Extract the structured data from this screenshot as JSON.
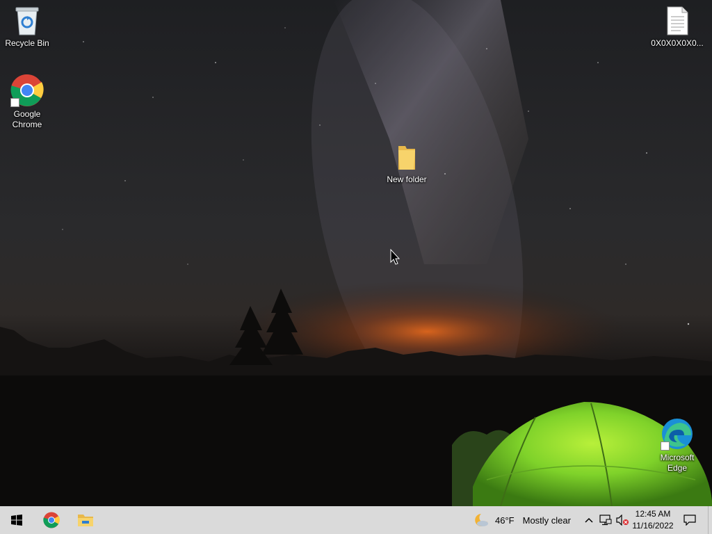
{
  "desktop": {
    "icons": [
      {
        "label": "Recycle Bin",
        "icon": "recycle-bin-icon"
      },
      {
        "label": "Google Chrome",
        "icon": "chrome-icon"
      },
      {
        "label": "New folder",
        "icon": "folder-icon"
      },
      {
        "label": "0X0X0X0X0...",
        "icon": "text-file-icon"
      },
      {
        "label": "Microsoft Edge",
        "icon": "edge-icon"
      }
    ]
  },
  "taskbar": {
    "pinned": [
      {
        "name": "Start",
        "icon": "windows-start-icon"
      },
      {
        "name": "Google Chrome",
        "icon": "chrome-icon"
      },
      {
        "name": "File Explorer",
        "icon": "file-explorer-icon"
      }
    ],
    "weather": {
      "temperature": "46°F",
      "condition": "Mostly clear",
      "icon": "moon-cloud-icon"
    },
    "tray": {
      "icons": [
        "chevron-up-icon",
        "network-icon",
        "volume-muted-icon"
      ]
    },
    "clock": {
      "time": "12:45 AM",
      "date": "11/16/2022"
    },
    "notification_icon": "notification-icon"
  },
  "colors": {
    "taskbar_bg": "#dadada",
    "tent_green": "#7fd22a",
    "horizon_orange": "#e0661c"
  }
}
